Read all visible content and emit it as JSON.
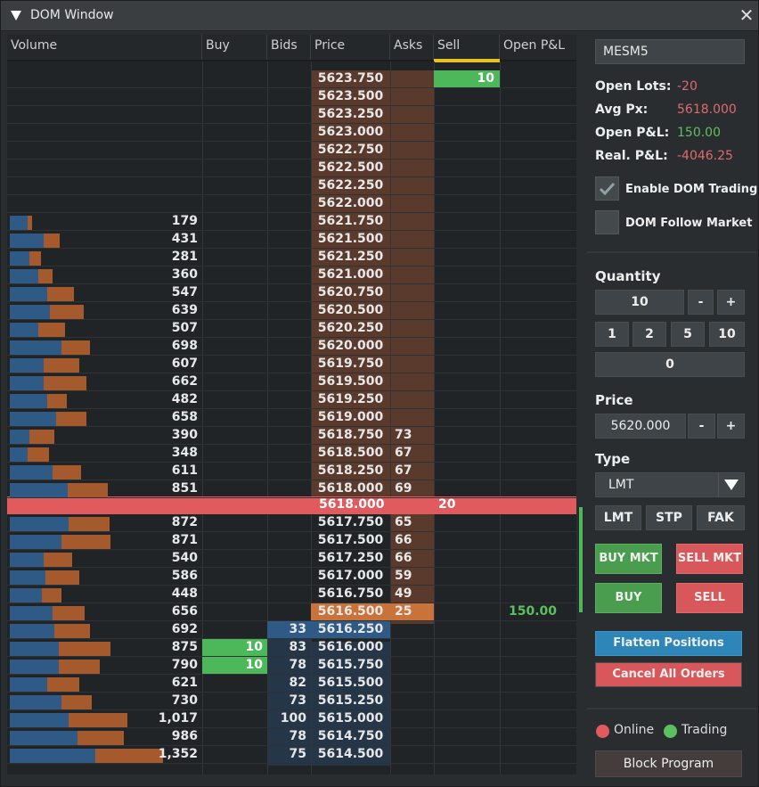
{
  "window": {
    "title": "DOM Window"
  },
  "columns": [
    "Volume",
    "Buy",
    "Bids",
    "Price",
    "Asks",
    "Sell",
    "Open P&L"
  ],
  "ladder": [
    {
      "price": "5623.750",
      "vol": "",
      "blue": 0,
      "orange": 0,
      "sell": "10"
    },
    {
      "price": "5623.500",
      "vol": "",
      "blue": 0,
      "orange": 0
    },
    {
      "price": "5623.250",
      "vol": "",
      "blue": 0,
      "orange": 0
    },
    {
      "price": "5623.000",
      "vol": "",
      "blue": 0,
      "orange": 0
    },
    {
      "price": "5622.750",
      "vol": "",
      "blue": 0,
      "orange": 0
    },
    {
      "price": "5622.500",
      "vol": "",
      "blue": 0,
      "orange": 0
    },
    {
      "price": "5622.250",
      "vol": "",
      "blue": 0,
      "orange": 0
    },
    {
      "price": "5622.000",
      "vol": "",
      "blue": 0,
      "orange": 0
    },
    {
      "price": "5621.750",
      "vol": "179",
      "blue": 20,
      "orange": 5
    },
    {
      "price": "5621.500",
      "vol": "431",
      "blue": 38,
      "orange": 18
    },
    {
      "price": "5621.250",
      "vol": "281",
      "blue": 22,
      "orange": 13
    },
    {
      "price": "5621.000",
      "vol": "360",
      "blue": 32,
      "orange": 16
    },
    {
      "price": "5620.750",
      "vol": "547",
      "blue": 42,
      "orange": 30
    },
    {
      "price": "5620.500",
      "vol": "639",
      "blue": 45,
      "orange": 38
    },
    {
      "price": "5620.250",
      "vol": "507",
      "blue": 32,
      "orange": 30
    },
    {
      "price": "5620.000",
      "vol": "698",
      "blue": 58,
      "orange": 32
    },
    {
      "price": "5619.750",
      "vol": "607",
      "blue": 38,
      "orange": 40
    },
    {
      "price": "5619.500",
      "vol": "662",
      "blue": 38,
      "orange": 48
    },
    {
      "price": "5619.250",
      "vol": "482",
      "blue": 42,
      "orange": 22
    },
    {
      "price": "5619.000",
      "vol": "658",
      "blue": 52,
      "orange": 34
    },
    {
      "price": "5618.750",
      "vol": "390",
      "blue": 22,
      "orange": 28
    },
    {
      "price": "5618.500",
      "vol": "348",
      "blue": 20,
      "orange": 24,
      "ask": "67"
    },
    {
      "price": "5618.250",
      "vol": "611",
      "blue": 48,
      "orange": 32,
      "ask": "67"
    },
    {
      "price": "5618.000",
      "vol": "851",
      "blue": 65,
      "orange": 45,
      "ask": "69"
    }
  ],
  "ask_first": "73",
  "current": {
    "price": "5618.000",
    "qty": "20"
  },
  "ladder_below": [
    {
      "price": "5617.750",
      "vol": "872",
      "blue": 66,
      "orange": 46,
      "ask": "65"
    },
    {
      "price": "5617.500",
      "vol": "871",
      "blue": 58,
      "orange": 55,
      "ask": "66"
    },
    {
      "price": "5617.250",
      "vol": "540",
      "blue": 38,
      "orange": 32,
      "ask": "66"
    },
    {
      "price": "5617.000",
      "vol": "586",
      "blue": 40,
      "orange": 38,
      "ask": "59"
    },
    {
      "price": "5616.750",
      "vol": "448",
      "blue": 36,
      "orange": 22,
      "ask": "49"
    },
    {
      "price": "5616.500",
      "vol": "656",
      "blue": 48,
      "orange": 36,
      "ask": "25",
      "pnl": "150.00"
    },
    {
      "price": "5616.250",
      "vol": "692",
      "blue": 50,
      "orange": 40,
      "bid": "33"
    },
    {
      "price": "5616.000",
      "vol": "875",
      "blue": 55,
      "orange": 58,
      "bid": "83",
      "buy": "10"
    },
    {
      "price": "5615.750",
      "vol": "790",
      "blue": 55,
      "orange": 46,
      "bid": "78",
      "buy": "10"
    },
    {
      "price": "5615.500",
      "vol": "621",
      "blue": 42,
      "orange": 36,
      "bid": "82"
    },
    {
      "price": "5615.250",
      "vol": "730",
      "blue": 58,
      "orange": 34,
      "bid": "73"
    },
    {
      "price": "5615.000",
      "vol": "1,017",
      "blue": 66,
      "orange": 66,
      "bid": "100"
    },
    {
      "price": "5614.750",
      "vol": "986",
      "blue": 76,
      "orange": 52,
      "bid": "78"
    },
    {
      "price": "5614.500",
      "vol": "1,352",
      "blue": 96,
      "orange": 76,
      "bid": "75"
    }
  ],
  "panel": {
    "symbol": "MESM5",
    "open_lots_label": "Open Lots:",
    "open_lots": "-20",
    "avg_px_label": "Avg Px:",
    "avg_px": "5618.000",
    "open_pnl_label": "Open P&L:",
    "open_pnl": "150.00",
    "real_pnl_label": "Real. P&L:",
    "real_pnl": "-4046.25",
    "enable_dom_label": "Enable DOM Trading",
    "follow_market_label": "DOM Follow Market",
    "quantity_label": "Quantity",
    "quantity": "10",
    "minus": "-",
    "plus": "+",
    "q1": "1",
    "q2": "2",
    "q5": "5",
    "q10": "10",
    "q_zero": "0",
    "price_label": "Price",
    "price": "5620.000",
    "type_label": "Type",
    "type": "LMT",
    "lmt": "LMT",
    "stp": "STP",
    "fak": "FAK",
    "buy_mkt": "BUY MKT",
    "sell_mkt": "SELL MKT",
    "buy": "BUY",
    "sell": "SELL",
    "flatten": "Flatten Positions",
    "cancel": "Cancel All Orders",
    "online": "Online",
    "trading": "Trading",
    "block": "Block Program"
  },
  "colors": {
    "green": "#4cb85a",
    "red": "#e05a5e",
    "blue": "#2f5a86",
    "orange": "#a45a2c",
    "accent_yellow": "#e6c21c"
  }
}
